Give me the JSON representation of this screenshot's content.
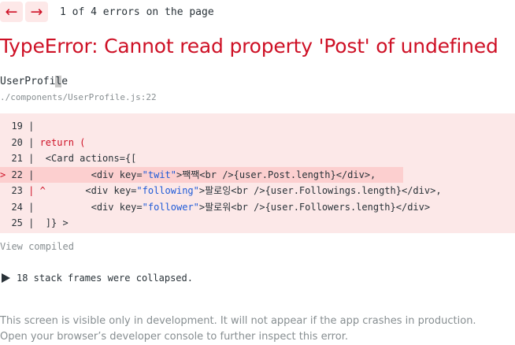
{
  "nav": {
    "prev_label": "←",
    "next_label": "→",
    "count_text": "1 of 4 errors on the page"
  },
  "error": {
    "title": "TypeError: Cannot read property 'Post' of undefined",
    "component_prefix": "UserProfi",
    "component_highlight": "l",
    "component_suffix": "e",
    "file": "./components/UserProfile.js:22"
  },
  "code": {
    "lines": [
      {
        "marker": "  ",
        "num": "19",
        "sep": " |",
        "text": ""
      },
      {
        "marker": "  ",
        "num": "20",
        "sep": " |",
        "text": " return ("
      },
      {
        "marker": "  ",
        "num": "21",
        "sep": " |",
        "text": "  <Card actions={["
      },
      {
        "marker": "> ",
        "num": "22",
        "sep": " |",
        "pre": "          <div key=",
        "str": "\"twit\"",
        "post": ">짹짹<br />{user.Post.length}</div>,"
      },
      {
        "marker": "  ",
        "num": "23",
        "sep": " | ^",
        "pre": "       <div key=",
        "str": "\"following\"",
        "post": ">팔로잉<br />{user.Followings.length}</div>,"
      },
      {
        "marker": "  ",
        "num": "24",
        "sep": " |",
        "pre": "          <div key=",
        "str": "\"follower\"",
        "post": ">팔로워<br />{user.Followers.length}</div>"
      },
      {
        "marker": "  ",
        "num": "25",
        "sep": " |",
        "text": "  ]} >"
      }
    ]
  },
  "view_compiled": "View compiled",
  "frames_text": "18 stack frames were collapsed.",
  "footer": {
    "line1": "This screen is visible only in development. It will not appear if the app crashes in production.",
    "line2": "Open your browser’s developer console to further inspect this error."
  },
  "colors": {
    "error_red": "#ce1126",
    "code_bg": "#fce8e8",
    "highlight_bg": "#fccfcf",
    "muted": "#878e91",
    "string_blue": "#1f5bd8"
  }
}
